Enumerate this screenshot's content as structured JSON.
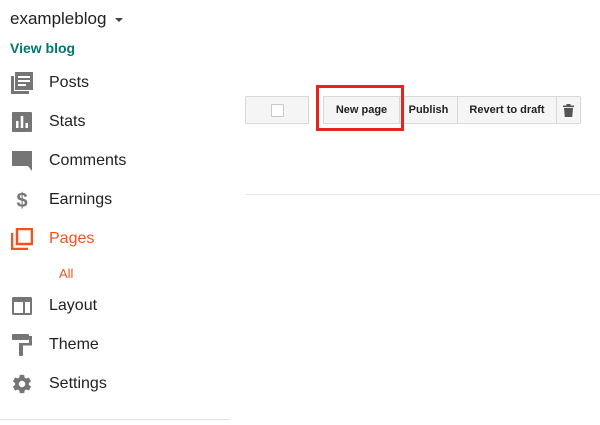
{
  "header": {
    "blog_name": "exampleblog",
    "view_blog_label": "View blog"
  },
  "sidebar": {
    "items": [
      {
        "label": "Posts",
        "icon": "posts-icon"
      },
      {
        "label": "Stats",
        "icon": "stats-icon"
      },
      {
        "label": "Comments",
        "icon": "comments-icon"
      },
      {
        "label": "Earnings",
        "icon": "earnings-icon"
      },
      {
        "label": "Pages",
        "icon": "pages-icon",
        "active": true
      },
      {
        "label": "Layout",
        "icon": "layout-icon"
      },
      {
        "label": "Theme",
        "icon": "theme-icon"
      },
      {
        "label": "Settings",
        "icon": "settings-icon"
      }
    ],
    "pages_subitem": "All"
  },
  "toolbar": {
    "new_page_label": "New page",
    "publish_label": "Publish",
    "revert_label": "Revert to draft",
    "trash_icon": "trash-icon"
  },
  "colors": {
    "accent": "#f4511e",
    "link": "#00796b",
    "icon": "#757575",
    "highlight": "#e8231d"
  }
}
